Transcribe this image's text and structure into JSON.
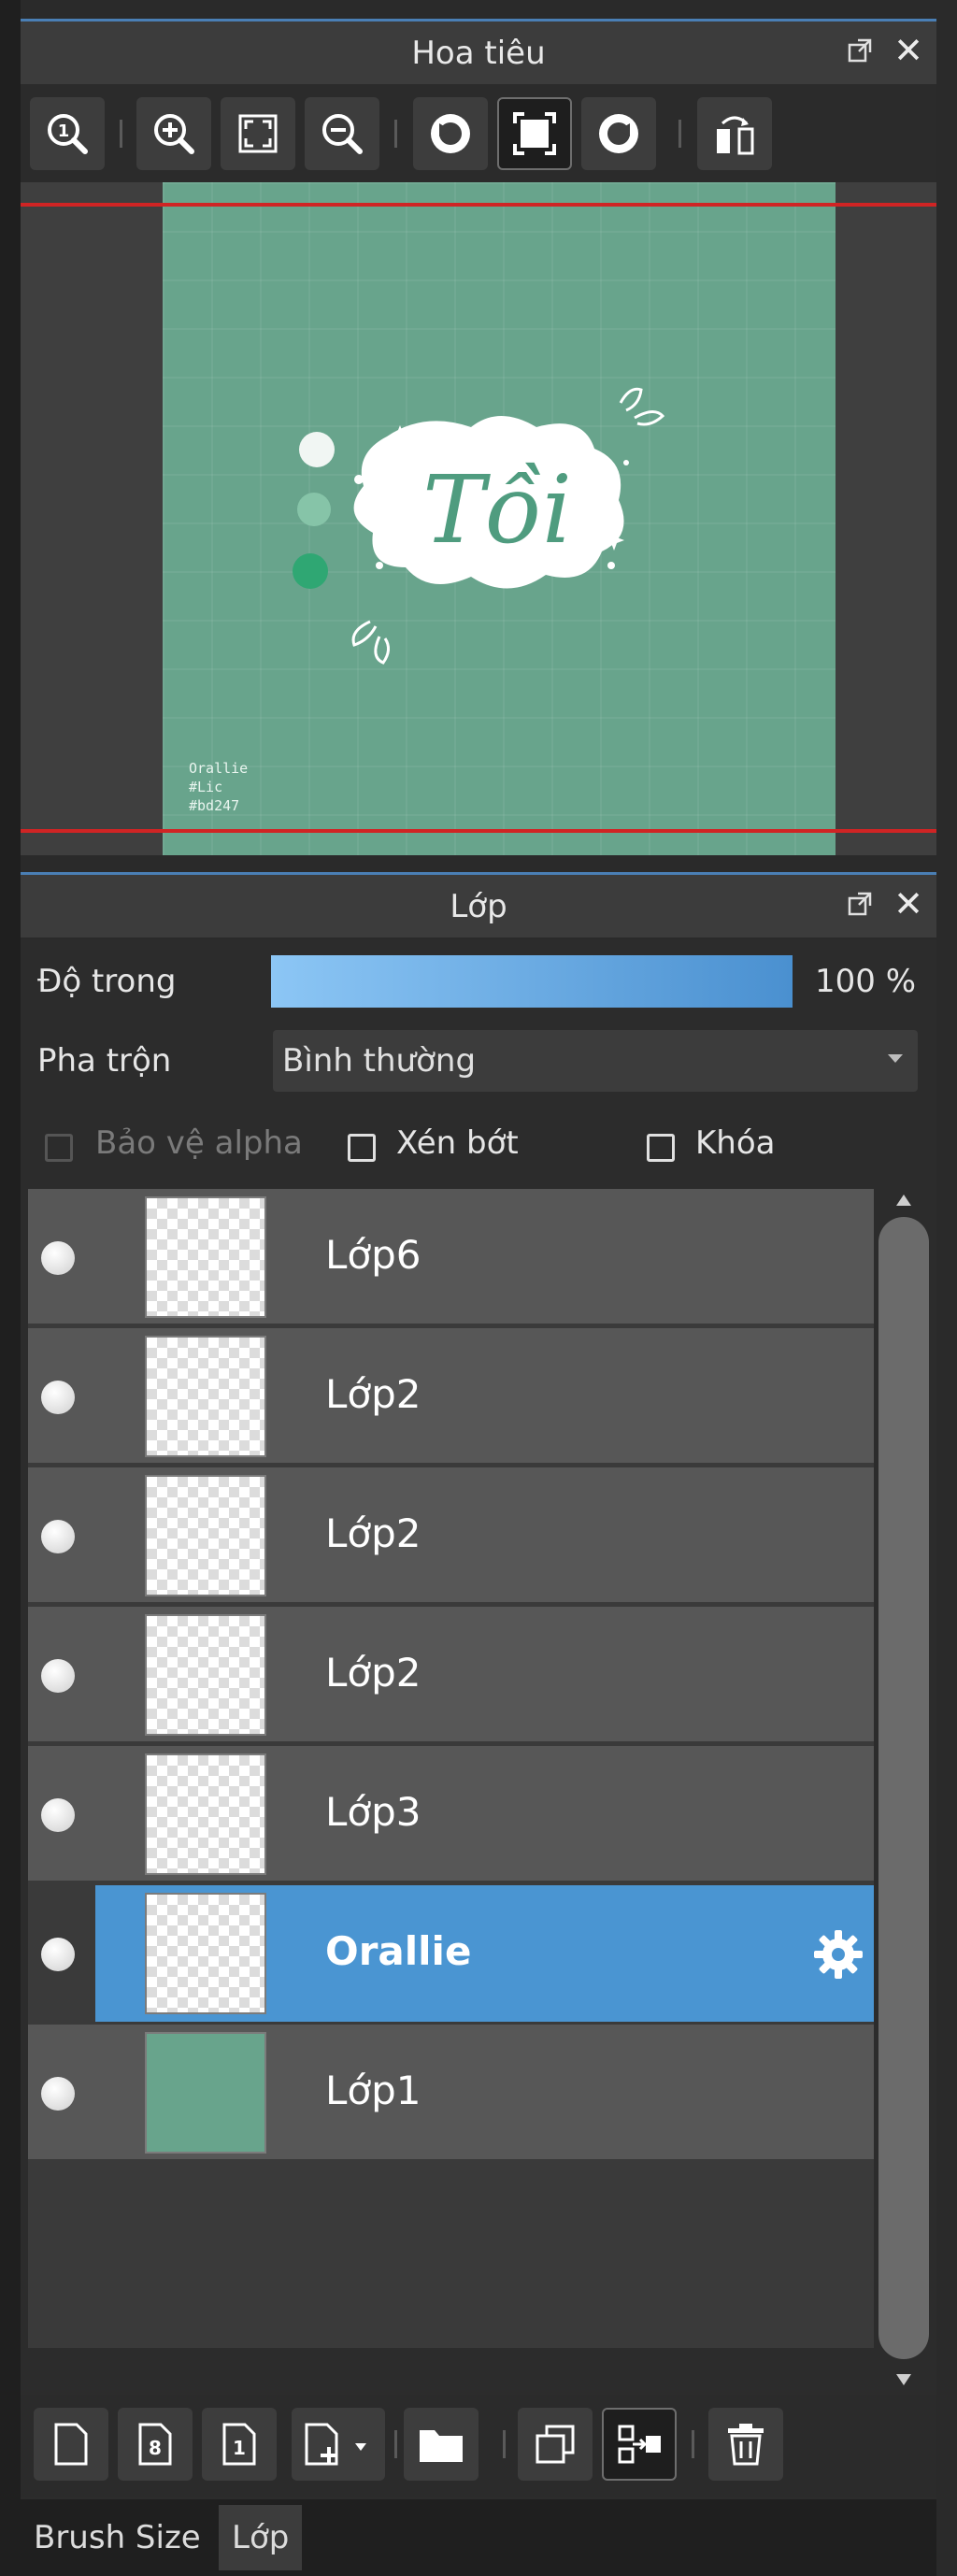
{
  "navigator": {
    "title": "Hoa tiêu",
    "toolbar": [
      "zoom-actual-icon",
      "zoom-in-icon",
      "fit-screen-icon",
      "zoom-out-icon",
      "rotate-left-icon",
      "fit-frame-icon",
      "rotate-right-icon",
      "flip-icon"
    ],
    "preview": {
      "art_title": "Tồi",
      "caption": [
        "Orallie",
        "#Lic",
        "#bd247"
      ],
      "bg_color": "#68a48c"
    }
  },
  "layers_panel": {
    "title": "Lớp",
    "opacity_label": "Độ trong",
    "opacity_value": "100 %",
    "opacity_fraction": 1.0,
    "blend_label": "Pha trộn",
    "blend_value": "Bình thường",
    "protect_alpha": "Bảo vệ alpha",
    "clipping": "Xén bớt",
    "lock": "Khóa",
    "layers": [
      {
        "name": "Lớp6",
        "selected": false,
        "thumb": "transparent"
      },
      {
        "name": "Lớp2",
        "selected": false,
        "thumb": "transparent"
      },
      {
        "name": "Lớp2",
        "selected": false,
        "thumb": "transparent"
      },
      {
        "name": "Lớp2",
        "selected": false,
        "thumb": "transparent"
      },
      {
        "name": "Lớp3",
        "selected": false,
        "thumb": "transparent"
      },
      {
        "name": "Orallie",
        "selected": true,
        "thumb": "transparent"
      },
      {
        "name": "Lớp1",
        "selected": false,
        "thumb": "solid-green"
      }
    ],
    "bottom_toolbar": [
      "new-layer-icon",
      "new-8bit-layer-icon",
      "new-1bit-layer-icon",
      "add-layer-menu-icon",
      "folder-icon",
      "duplicate-icon",
      "merge-icon",
      "delete-icon"
    ]
  },
  "tabs": [
    "Brush Size",
    "Lớp"
  ],
  "colors": {
    "accent": "#4a95d2",
    "art_green": "#68a48c",
    "red_frame": "#d02424"
  }
}
